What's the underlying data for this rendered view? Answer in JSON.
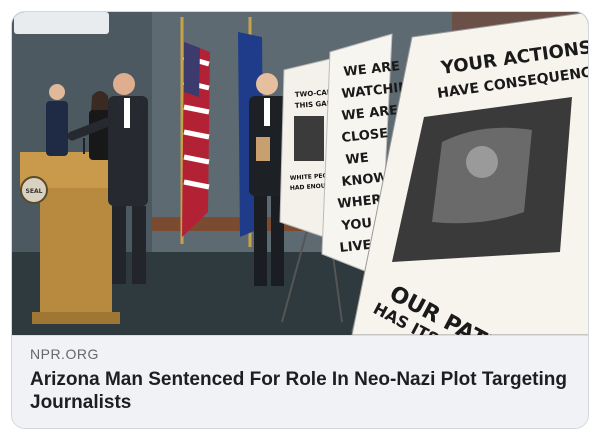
{
  "link_card": {
    "source": "NPR.ORG",
    "headline": "Arizona Man Sentenced For Role In Neo-Nazi Plot Targeting Journalists"
  },
  "photo": {
    "podium_seal": "SEAL",
    "poster_left": {
      "line1": "TWO-CAN-PLAY",
      "line2": "THIS GAME",
      "line3": "WHITE PEOPLE HAVE",
      "line4": "HAD ENOUGH"
    },
    "poster_middle": {
      "lines": [
        "WE ARE",
        "WATCHING",
        "WE ARE",
        "CLOSE",
        "WE",
        "KNOW",
        "WHERE",
        "YOU",
        "LIVE"
      ]
    },
    "poster_right": {
      "top_line1": "YOUR ACTIONS",
      "top_line2": "HAVE CONSEQUENCE.",
      "bottom_line1": "OUR PATIENCE",
      "bottom_line2": "HAS ITS LIMITS"
    }
  },
  "colors": {
    "card_bg": "#f1f2f5",
    "headline": "#1c1e21",
    "source": "#65676b"
  }
}
